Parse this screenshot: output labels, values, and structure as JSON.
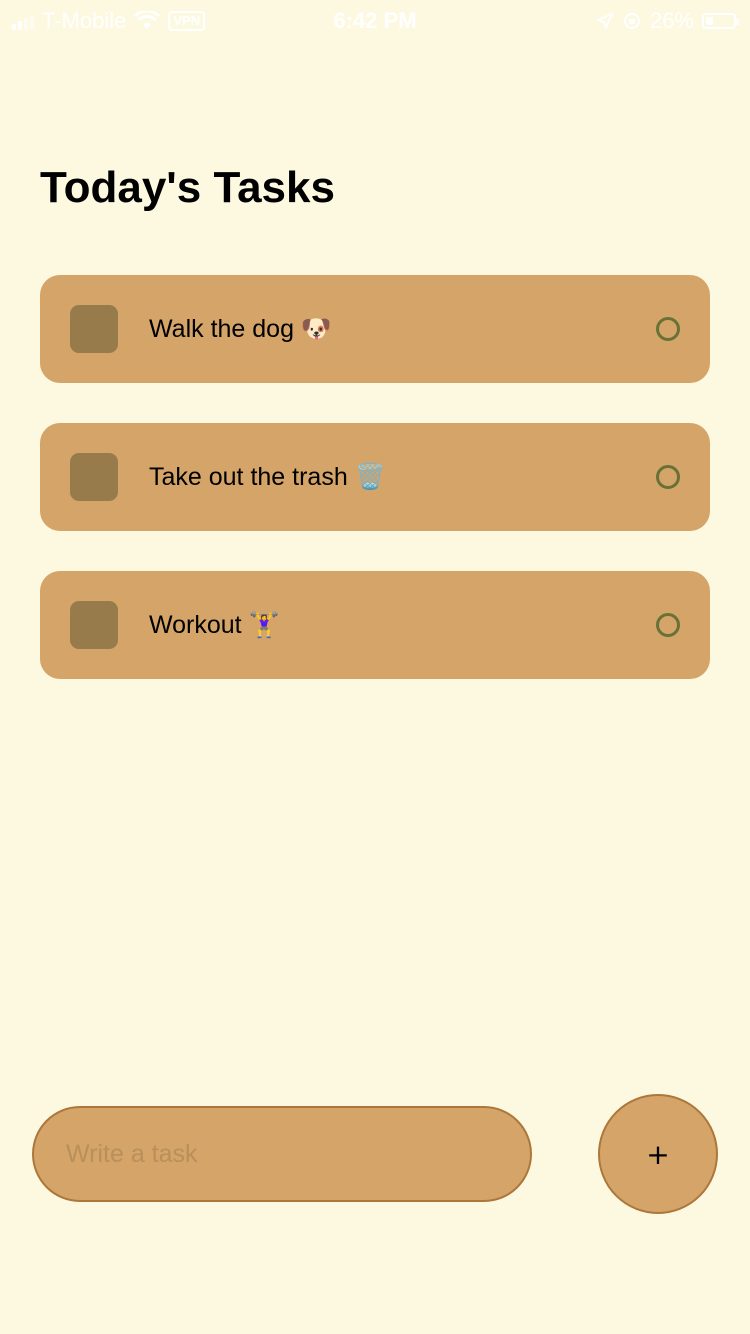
{
  "status_bar": {
    "carrier": "T-Mobile",
    "vpn": "VPN",
    "time": "6:42 PM",
    "battery": "26%",
    "battery_level": 0.26
  },
  "header": {
    "title": "Today's Tasks"
  },
  "tasks": [
    {
      "label": "Walk the dog 🐶"
    },
    {
      "label": "Take out the trash 🗑️"
    },
    {
      "label": "Workout 🏋️‍♀️"
    }
  ],
  "composer": {
    "placeholder": "Write a task",
    "add_label": "+"
  },
  "colors": {
    "background": "#fcf9e0",
    "card": "#d4a469",
    "square": "#977b4a",
    "circle": "#6a7137",
    "border": "#ad773b"
  }
}
